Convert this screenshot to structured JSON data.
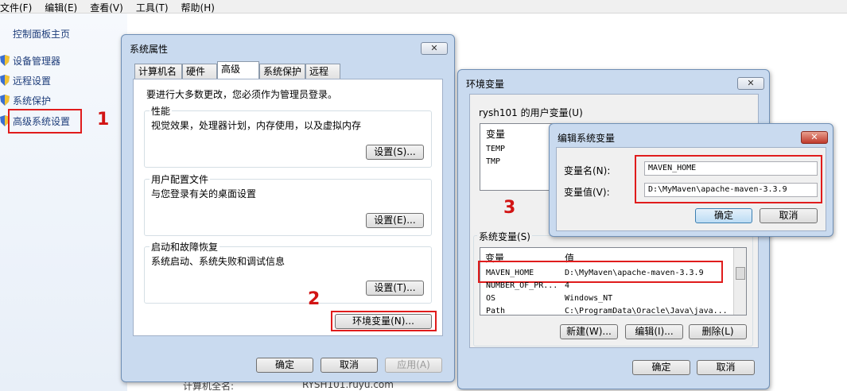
{
  "menubar": [
    "文件(F)",
    "编辑(E)",
    "查看(V)",
    "工具(T)",
    "帮助(H)"
  ],
  "left_panel": {
    "home": "控制面板主页",
    "items": [
      "设备管理器",
      "远程设置",
      "系统保护",
      "高级系统设置"
    ]
  },
  "steps": [
    "1",
    "2",
    "3"
  ],
  "background": {
    "computer_name_label": "计算机全名:",
    "computer_name_value": "RYSH101.ruyu.com"
  },
  "sysprops": {
    "title": "系统属性",
    "tabs": [
      "计算机名",
      "硬件",
      "高级",
      "系统保护",
      "远程"
    ],
    "admin_note": "要进行大多数更改，您必须作为管理员登录。",
    "groups": [
      {
        "title": "性能",
        "desc": "视觉效果，处理器计划，内存使用，以及虚拟内存",
        "button": "设置(S)..."
      },
      {
        "title": "用户配置文件",
        "desc": "与您登录有关的桌面设置",
        "button": "设置(E)..."
      },
      {
        "title": "启动和故障恢复",
        "desc": "系统启动、系统失败和调试信息",
        "button": "设置(T)..."
      }
    ],
    "env_button": "环境变量(N)...",
    "ok": "确定",
    "cancel": "取消",
    "apply": "应用(A)"
  },
  "envvars": {
    "title": "环境变量",
    "user_section": "rysh101 的用户变量(U)",
    "user_header": "变量",
    "user_rows": [
      "TEMP",
      "TMP"
    ],
    "system_section": "系统变量(S)",
    "system_headers": [
      "变量",
      "值"
    ],
    "system_rows": [
      {
        "name": "MAVEN_HOME",
        "value": "D:\\MyMaven\\apache-maven-3.3.9"
      },
      {
        "name": "NUMBER_OF_PR...",
        "value": "4"
      },
      {
        "name": "OS",
        "value": "Windows_NT"
      },
      {
        "name": "Path",
        "value": "C:\\ProgramData\\Oracle\\Java\\java..."
      }
    ],
    "new": "新建(W)...",
    "edit": "编辑(I)...",
    "delete": "删除(L)",
    "ok": "确定",
    "cancel": "取消"
  },
  "editvar": {
    "title": "编辑系统变量",
    "name_label": "变量名(N):",
    "name_value": "MAVEN_HOME",
    "value_label": "变量值(V):",
    "value_value": "D:\\MyMaven\\apache-maven-3.3.9",
    "ok": "确定",
    "cancel": "取消"
  }
}
